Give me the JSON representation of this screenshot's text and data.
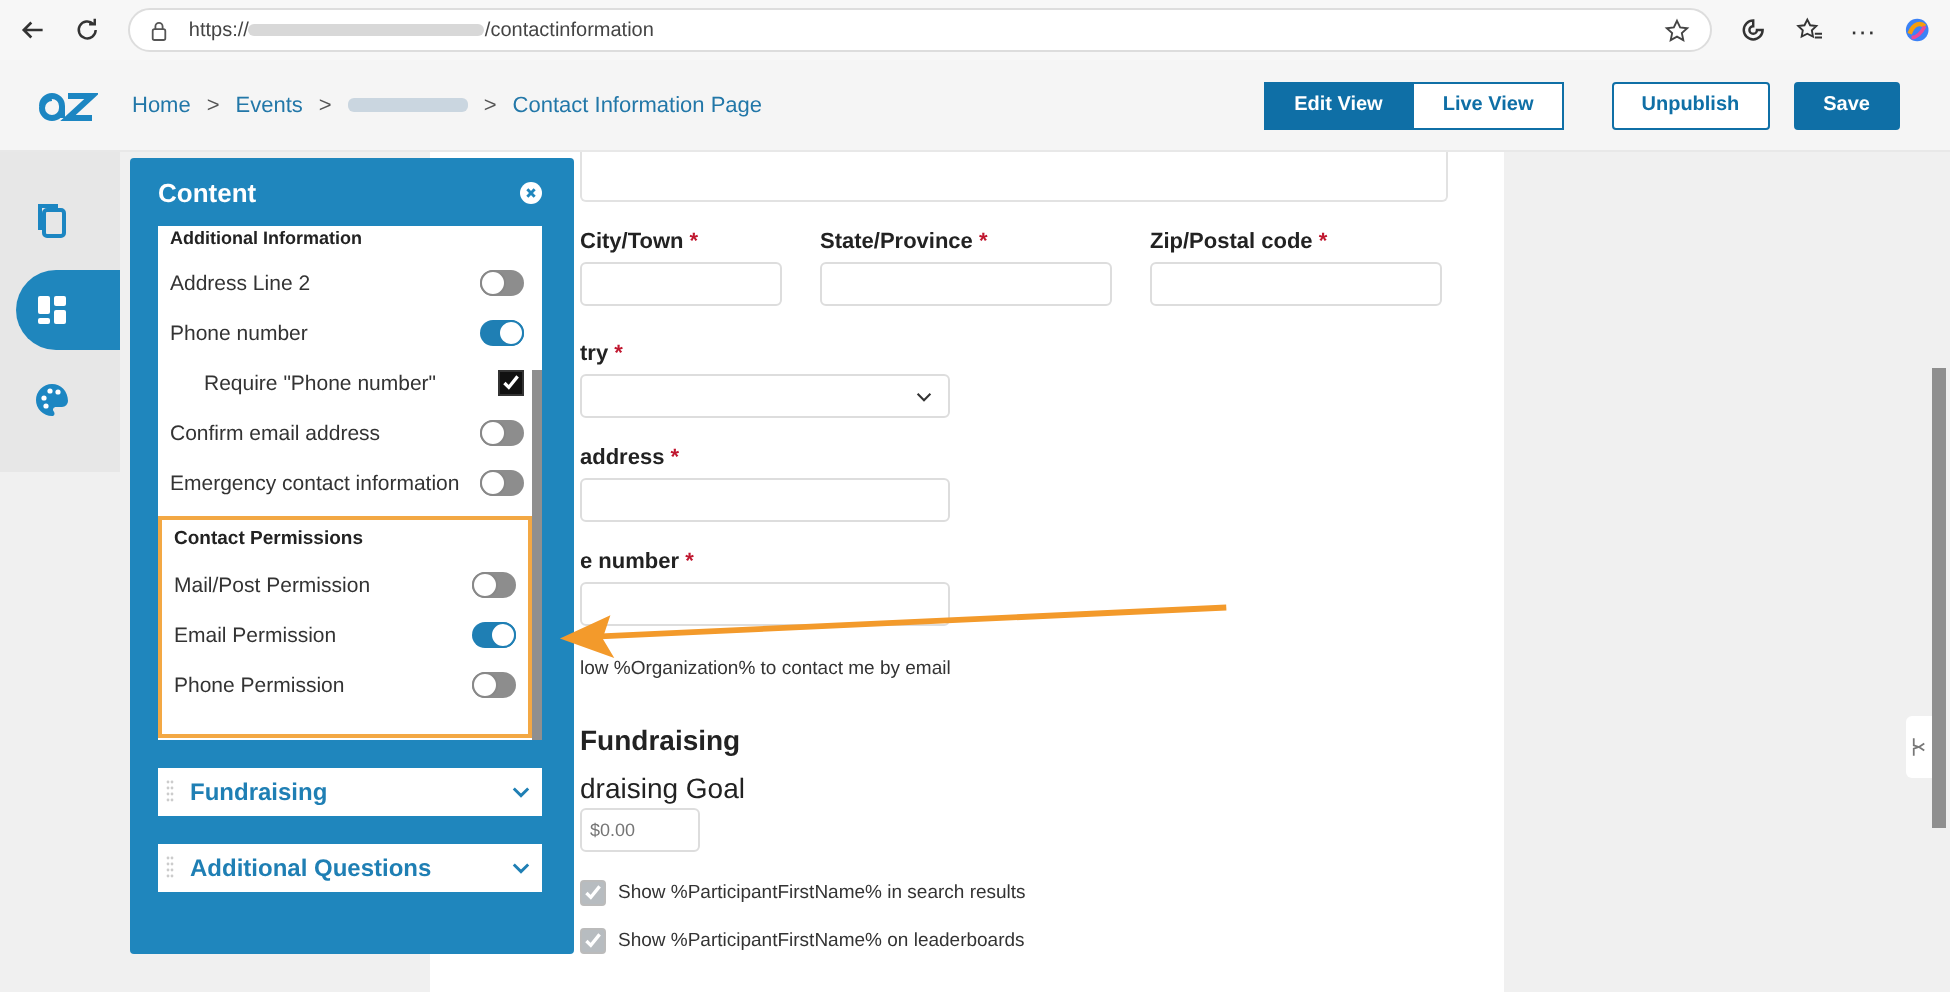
{
  "browser": {
    "url_start": "https://",
    "url_end": "/contactinformation",
    "more": "···"
  },
  "header": {
    "breadcrumbs": [
      {
        "kind": "link",
        "label": "Home",
        "separator": ">"
      },
      {
        "kind": "link",
        "label": "Events",
        "separator": ">"
      },
      {
        "kind": "redacted",
        "separator": ">"
      },
      {
        "kind": "link",
        "label": "Contact Information Page"
      }
    ],
    "views": [
      {
        "label": "Edit View",
        "selected": true
      },
      {
        "label": "Live View",
        "selected": false
      }
    ],
    "buttons": [
      {
        "label": "Unpublish",
        "kind": "outline"
      },
      {
        "label": "Save",
        "kind": "primary"
      }
    ]
  },
  "rail": [
    {
      "kind": "copy",
      "selected": false
    },
    {
      "kind": "layout",
      "selected": true
    },
    {
      "kind": "palette",
      "selected": false
    }
  ],
  "panel": {
    "title": "Content",
    "section": "Additional Information",
    "items": [
      {
        "kind": "toggle",
        "label": "Address Line 2",
        "on": false
      },
      {
        "kind": "toggle",
        "label": "Phone number",
        "on": true
      },
      {
        "kind": "checkbox",
        "label": "Require \"Phone number\"",
        "checked": true
      },
      {
        "kind": "toggle",
        "label": "Confirm email address",
        "on": false
      },
      {
        "kind": "toggle",
        "label": "Emergency contact information",
        "on": false
      }
    ],
    "permissions": {
      "title": "Contact Permissions",
      "items": [
        {
          "kind": "toggle",
          "label": "Mail/Post Permission",
          "on": false
        },
        {
          "kind": "toggle",
          "label": "Email Permission",
          "on": true
        },
        {
          "kind": "toggle",
          "label": "Phone Permission",
          "on": false
        }
      ]
    },
    "accordions": [
      {
        "label": "Fundraising",
        "expanded": false
      },
      {
        "label": "Additional Questions",
        "expanded": false
      }
    ]
  },
  "form": {
    "row": [
      {
        "label": "City/Town",
        "mark": "*"
      },
      {
        "label": "State/Province",
        "mark": "*"
      },
      {
        "label": "Zip/Postal code",
        "mark": "*"
      }
    ],
    "country": {
      "label": "try",
      "mark": "*"
    },
    "email": {
      "label": "address",
      "mark": "*"
    },
    "phone": {
      "label": "e number",
      "mark": "*"
    },
    "consent": "low %Organization% to contact me by email",
    "heading": "Fundraising",
    "goal": {
      "label": "draising Goal",
      "placeholder": "$0.00"
    },
    "options": [
      {
        "label": "Show %ParticipantFirstName% in search results",
        "checked": true
      },
      {
        "label": "Show %ParticipantFirstName% on leaderboards",
        "checked": true
      }
    ]
  }
}
